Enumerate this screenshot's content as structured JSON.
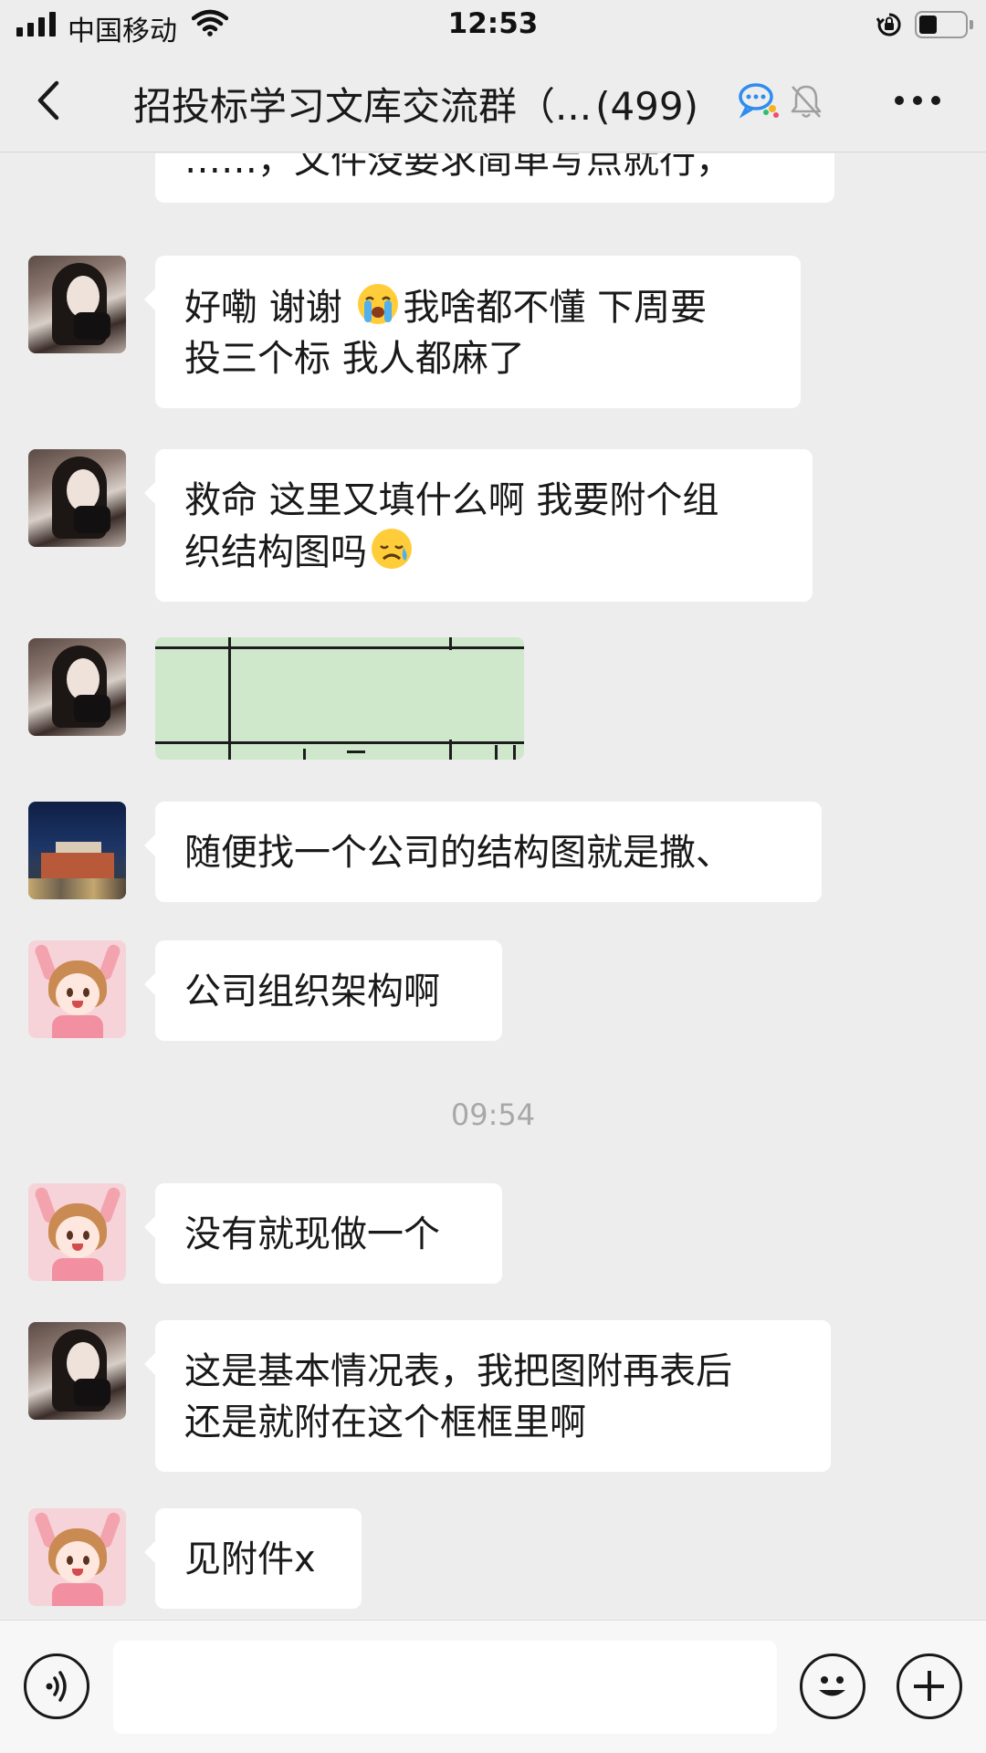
{
  "status_bar": {
    "carrier": "中国移动",
    "time": "12:53",
    "battery_level": 0.4
  },
  "header": {
    "title": "招投标学习文库交流群（...",
    "member_count": "(499)"
  },
  "messages": [
    {
      "type": "text",
      "sender": "partial",
      "text": "……，文件没要求简单写点就行，"
    },
    {
      "type": "text",
      "sender": "user-a",
      "line1_before_emoji": "好嘞 谢谢 ",
      "emoji": "loudly-crying-face",
      "line1_after_emoji": "我啥都不懂 下周要",
      "line2": "投三个标  我人都麻了"
    },
    {
      "type": "text",
      "sender": "user-a",
      "line1": "救命 这里又填什么啊 我要附个组",
      "line2_before_emoji": "织结构图吗",
      "emoji": "crying-face"
    },
    {
      "type": "image",
      "sender": "user-a",
      "description_icon": "spreadsheet-image"
    },
    {
      "type": "text",
      "sender": "user-b",
      "text": "随便找一个公司的结构图就是撒、"
    },
    {
      "type": "text",
      "sender": "user-c",
      "text": "公司组织架构啊"
    },
    {
      "type": "timestamp",
      "text": "09:54"
    },
    {
      "type": "text",
      "sender": "user-c",
      "text": "没有就现做一个"
    },
    {
      "type": "text",
      "sender": "user-a",
      "line1": "这是基本情况表，我把图附再表后",
      "line2": "还是就附在这个框框里啊"
    },
    {
      "type": "text",
      "sender": "user-c",
      "text": "见附件x"
    }
  ],
  "input_bar": {
    "placeholder": ""
  },
  "colors": {
    "background": "#ededed",
    "bubble": "#ffffff",
    "text": "#191919",
    "timestamp": "#a8a8a8"
  }
}
